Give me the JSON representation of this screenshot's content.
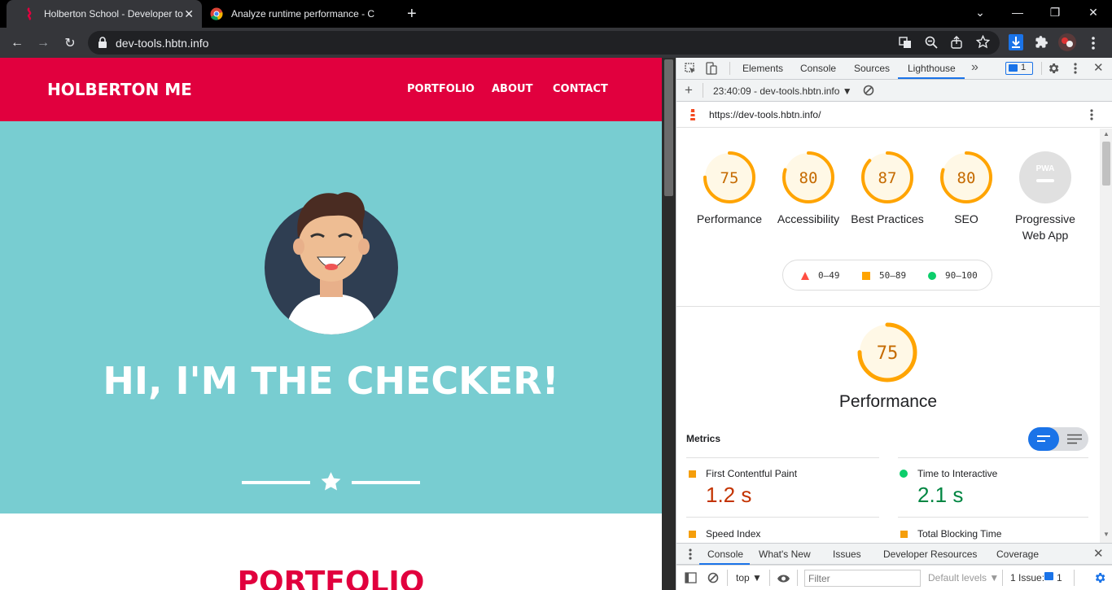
{
  "tabs": [
    {
      "title": "Holberton School - Developer to",
      "close": "✕"
    },
    {
      "title": "Analyze runtime performance - C"
    }
  ],
  "new_tab": "+",
  "window": {
    "minimize": "—",
    "maximize": "❐",
    "close": "✕",
    "tab_search": "⌄"
  },
  "toolbar": {
    "url": "dev-tools.hbtn.info",
    "back": "←",
    "forward": "→",
    "reload": "↻"
  },
  "site": {
    "brand": "HOLBERTON ME",
    "nav": [
      "PORTFOLIO",
      "ABOUT",
      "CONTACT"
    ],
    "hero_title": "HI, I'M THE CHECKER!",
    "section_title": "PORTFOLIO",
    "colors": {
      "navbar": "#e1003e",
      "hero": "#78cdd1"
    }
  },
  "devtools": {
    "tabs": [
      "Elements",
      "Console",
      "Sources",
      "Lighthouse"
    ],
    "active_tab": "Lighthouse",
    "more_tabs": "»",
    "issues_badge": "1",
    "report_selector": "23:40:09 - dev-tools.hbtn.info ▼",
    "add": "+",
    "report_url": "https://dev-tools.hbtn.info/",
    "gauges": [
      {
        "score": "75",
        "label": "Performance",
        "fraction": 0.75
      },
      {
        "score": "80",
        "label": "Accessibility",
        "fraction": 0.8
      },
      {
        "score": "87",
        "label": "Best Practices",
        "fraction": 0.87
      },
      {
        "score": "80",
        "label": "SEO",
        "fraction": 0.8
      },
      {
        "score": "PWA",
        "label": "Progressive Web App",
        "fraction": 0
      }
    ],
    "legend": [
      {
        "range": "0–49",
        "color": "#ff4e42"
      },
      {
        "range": "50–89",
        "color": "#ffa400"
      },
      {
        "range": "90–100",
        "color": "#0cce6b"
      }
    ],
    "performance": {
      "score": "75",
      "title": "Performance",
      "fraction": 0.75
    },
    "metrics_heading": "Metrics",
    "metrics": [
      {
        "title": "First Contentful Paint",
        "value": "1.2 s",
        "color": "#c33300",
        "marker": "#f59e0b"
      },
      {
        "title": "Time to Interactive",
        "value": "2.1 s",
        "color": "#018642",
        "marker": "#0cce6b"
      },
      {
        "title": "Speed Index",
        "value": "",
        "color": "#c33300",
        "marker": "#f59e0b"
      },
      {
        "title": "Total Blocking Time",
        "value": "",
        "color": "#c33300",
        "marker": "#f59e0b"
      }
    ],
    "drawer_tabs": [
      "Console",
      "What's New",
      "Issues",
      "Developer Resources",
      "Coverage"
    ],
    "drawer_active": "Console",
    "console_toolbar": {
      "context": "top ▼",
      "filter_placeholder": "Filter",
      "levels": "Default levels ▼",
      "issues": "1 Issue:",
      "issues_count": "1"
    }
  }
}
